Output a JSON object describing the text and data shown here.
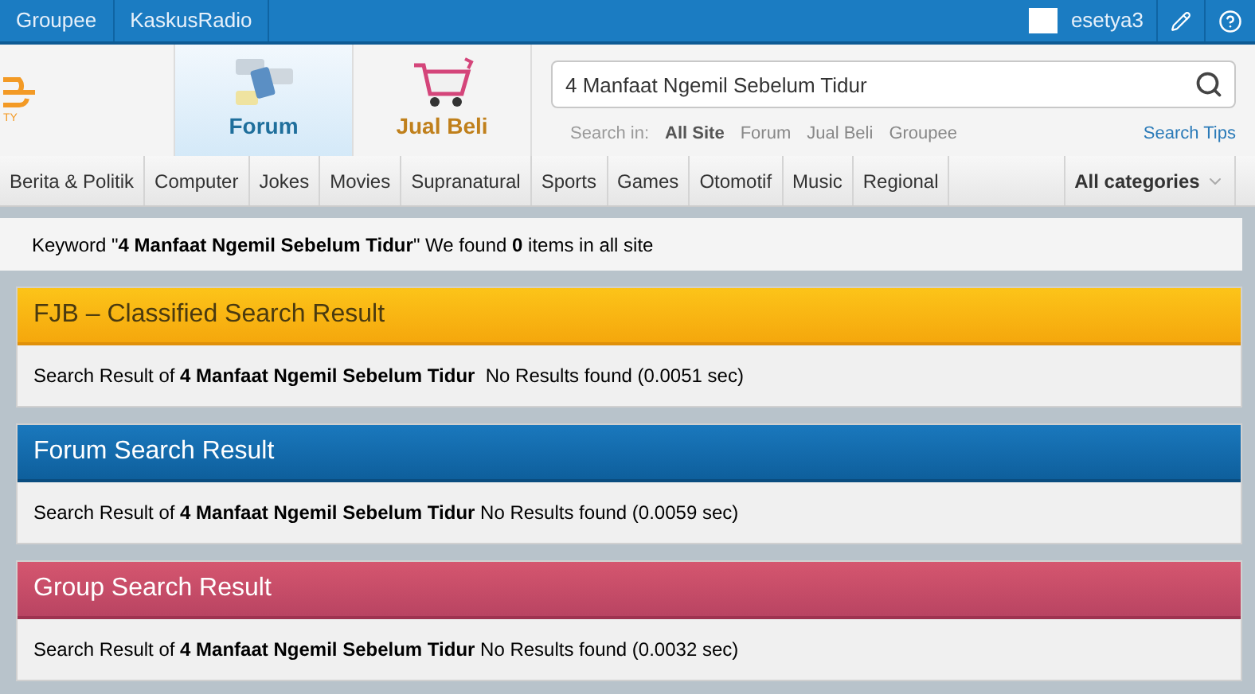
{
  "top_links": [
    "Groupee",
    "KaskusRadio"
  ],
  "user": {
    "name": "esetya3"
  },
  "logo": {
    "text": "TY"
  },
  "nav_tabs": [
    {
      "label": "Forum",
      "kind": "forum",
      "selected": true
    },
    {
      "label": "Jual Beli",
      "kind": "cart",
      "selected": false
    }
  ],
  "search": {
    "value": "4 Manfaat Ngemil Sebelum Tidur",
    "scope_label": "Search in:",
    "scopes": [
      {
        "label": "All Site",
        "selected": true
      },
      {
        "label": "Forum",
        "selected": false
      },
      {
        "label": "Jual Beli",
        "selected": false
      },
      {
        "label": "Groupee",
        "selected": false
      }
    ],
    "tips": "Search Tips"
  },
  "categories": [
    "Berita & Politik",
    "Computer",
    "Jokes",
    "Movies",
    "Supranatural",
    "Sports",
    "Games",
    "Otomotif",
    "Music",
    "Regional"
  ],
  "all_categories": "All categories",
  "summary": "Keyword \"**4 Manfaat Ngemil Sebelum Tidur**\" We found **0** items in all site",
  "sections": [
    {
      "title": "FJB – Classified Search Result",
      "kind": "fjb",
      "result": "Search Result of **4 Manfaat Ngemil Sebelum Tidur**  No Results found (0.0051 sec)"
    },
    {
      "title": "Forum Search Result",
      "kind": "forum",
      "result": "Search Result of **4 Manfaat Ngemil Sebelum Tidur** No Results found (0.0059 sec)"
    },
    {
      "title": "Group Search Result",
      "kind": "group",
      "result": "Search Result of **4 Manfaat Ngemil Sebelum Tidur** No Results found (0.0032 sec)"
    }
  ]
}
